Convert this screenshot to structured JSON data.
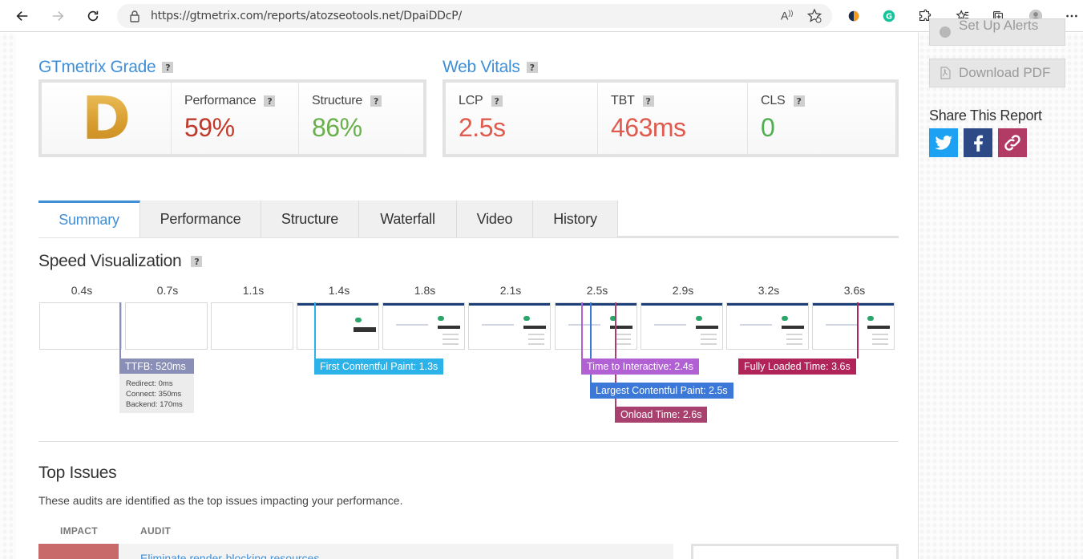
{
  "browser": {
    "url": "https://gtmetrix.com/reports/atozseotools.net/DpaiDDcP/",
    "read_aloud_label": "A͈"
  },
  "sidebar": {
    "setup_alerts": "Set Up Alerts",
    "download_pdf": "Download PDF",
    "share_title": "Share This Report"
  },
  "grade": {
    "title": "GTmetrix Grade",
    "help": "?",
    "letter": "D",
    "performance_label": "Performance",
    "performance_value": "59%",
    "structure_label": "Structure",
    "structure_value": "86%"
  },
  "vitals": {
    "title": "Web Vitals",
    "help": "?",
    "lcp_label": "LCP",
    "lcp_value": "2.5s",
    "tbt_label": "TBT",
    "tbt_value": "463ms",
    "cls_label": "CLS",
    "cls_value": "0"
  },
  "tabs": [
    "Summary",
    "Performance",
    "Structure",
    "Waterfall",
    "Video",
    "History"
  ],
  "speed": {
    "title": "Speed Visualization",
    "help": "?",
    "ticks": [
      "0.4s",
      "0.7s",
      "1.1s",
      "1.4s",
      "1.8s",
      "2.1s",
      "2.5s",
      "2.9s",
      "3.2s",
      "3.6s"
    ],
    "markers": {
      "ttfb": "TTFB: 520ms",
      "fcp": "First Contentful Paint: 1.3s",
      "tti": "Time to Interactive: 2.4s",
      "lcp": "Largest Contentful Paint: 2.5s",
      "onload": "Onload Time: 2.6s",
      "fully": "Fully Loaded Time: 3.6s"
    },
    "ttfb_detail": {
      "redirect": "Redirect: 0ms",
      "connect": "Connect: 350ms",
      "backend": "Backend: 170ms"
    }
  },
  "issues": {
    "title": "Top Issues",
    "description": "These audits are identified as the top issues impacting your performance.",
    "col_impact": "IMPACT",
    "col_audit": "AUDIT",
    "first_row_audit": "Eliminate render-blocking resources"
  },
  "colors": {
    "accent": "#3f8fd8",
    "performance": "#c0392b",
    "structure": "#6ab04c",
    "lcp": "#e05a4e",
    "cls": "#4caf50",
    "ttfb": "#8a8fb8",
    "fcp": "#2bb2e8",
    "tti": "#b161d4",
    "lcp_marker": "#3b78d8",
    "onload": "#a9416e",
    "fully": "#b0245a"
  }
}
